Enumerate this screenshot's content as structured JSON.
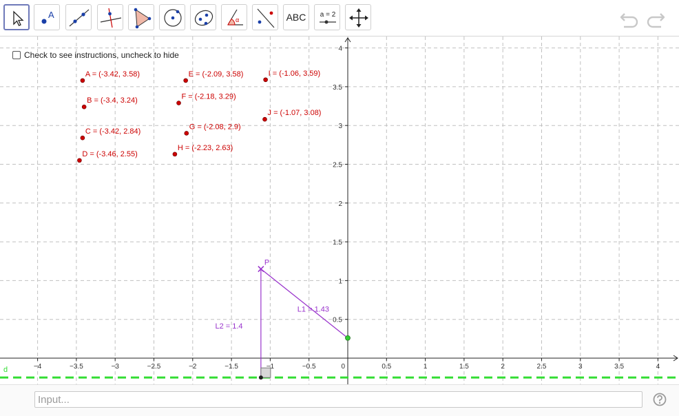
{
  "toolbar": {
    "tools": [
      {
        "name": "move-tool",
        "icon": "arrow-cursor-icon"
      },
      {
        "name": "point-tool",
        "icon": "point-icon",
        "label": "A"
      },
      {
        "name": "line-tool",
        "icon": "line-icon"
      },
      {
        "name": "perpendicular-line-tool",
        "icon": "perpendicular-icon"
      },
      {
        "name": "polygon-tool",
        "icon": "polygon-icon"
      },
      {
        "name": "circle-tool",
        "icon": "circle-icon"
      },
      {
        "name": "ellipse-tool",
        "icon": "ellipse-icon"
      },
      {
        "name": "angle-tool",
        "icon": "angle-icon",
        "label": "α"
      },
      {
        "name": "reflect-tool",
        "icon": "reflect-icon"
      },
      {
        "name": "text-tool",
        "icon": "text-icon",
        "label": "ABC"
      },
      {
        "name": "slider-tool",
        "icon": "slider-icon",
        "label": "a = 2"
      },
      {
        "name": "move-graphics-tool",
        "icon": "move-view-icon"
      }
    ],
    "undo_icon": "undo-icon",
    "redo_icon": "redo-icon"
  },
  "instructions": {
    "label": "Check to see instructions, uncheck to hide"
  },
  "axes": {
    "x_ticks": [
      "−4",
      "−3.5",
      "−3",
      "−2.5",
      "−2",
      "−1.5",
      "−1",
      "−0.5",
      "0",
      "0.5",
      "1",
      "1.5",
      "2",
      "2.5",
      "3",
      "3.5",
      "4"
    ],
    "x_values": [
      -4,
      -3.5,
      -3,
      -2.5,
      -2,
      -1.5,
      -1,
      -0.5,
      0,
      0.5,
      1,
      1.5,
      2,
      2.5,
      3,
      3.5,
      4
    ],
    "y_ticks": [
      "0.5",
      "1",
      "1.5",
      "2",
      "2.5",
      "3",
      "3.5",
      "4"
    ],
    "y_values": [
      0.5,
      1,
      1.5,
      2,
      2.5,
      3,
      3.5,
      4
    ]
  },
  "points": [
    {
      "id": "A",
      "label": "A = (-3.42, 3.58)",
      "x": -3.42,
      "y": 3.58
    },
    {
      "id": "B",
      "label": "B = (-3.4, 3.24)",
      "x": -3.4,
      "y": 3.24
    },
    {
      "id": "C",
      "label": "C = (-3.42, 2.84)",
      "x": -3.42,
      "y": 2.84
    },
    {
      "id": "D",
      "label": "D = (-3.46, 2.55)",
      "x": -3.46,
      "y": 2.55
    },
    {
      "id": "E",
      "label": "E = (-2.09, 3.58)",
      "x": -2.09,
      "y": 3.58
    },
    {
      "id": "F",
      "label": "F = (-2.18, 3.29)",
      "x": -2.18,
      "y": 3.29
    },
    {
      "id": "G",
      "label": "G = (-2.08, 2.9)",
      "x": -2.08,
      "y": 2.9
    },
    {
      "id": "H",
      "label": "H = (-2.23, 2.63)",
      "x": -2.23,
      "y": 2.63
    },
    {
      "id": "I",
      "label": "I = (-1.06, 3.59)",
      "x": -1.06,
      "y": 3.59
    },
    {
      "id": "J",
      "label": "J = (-1.07, 3.08)",
      "x": -1.07,
      "y": 3.08
    }
  ],
  "construction": {
    "P": {
      "label": "P",
      "x": -1.12,
      "y": 1.15
    },
    "y_axis_point": {
      "x": 0,
      "y": 0.26
    },
    "foot_point": {
      "x": -1.12,
      "y": -0.25
    },
    "line_d": {
      "label": "d",
      "y": -0.25
    },
    "L1": {
      "label": "L1 = 1.43"
    },
    "L2": {
      "label": "L2 = 1.4"
    }
  },
  "colors": {
    "point": "#cc0000",
    "label": "#cc0000",
    "construction": "#9933cc",
    "line_d": "#33dd33",
    "axis_point": "#33cc33",
    "grid": "#c0c0c0",
    "axis": "#222222"
  },
  "input": {
    "placeholder": "Input..."
  },
  "help_icon": "help-icon"
}
